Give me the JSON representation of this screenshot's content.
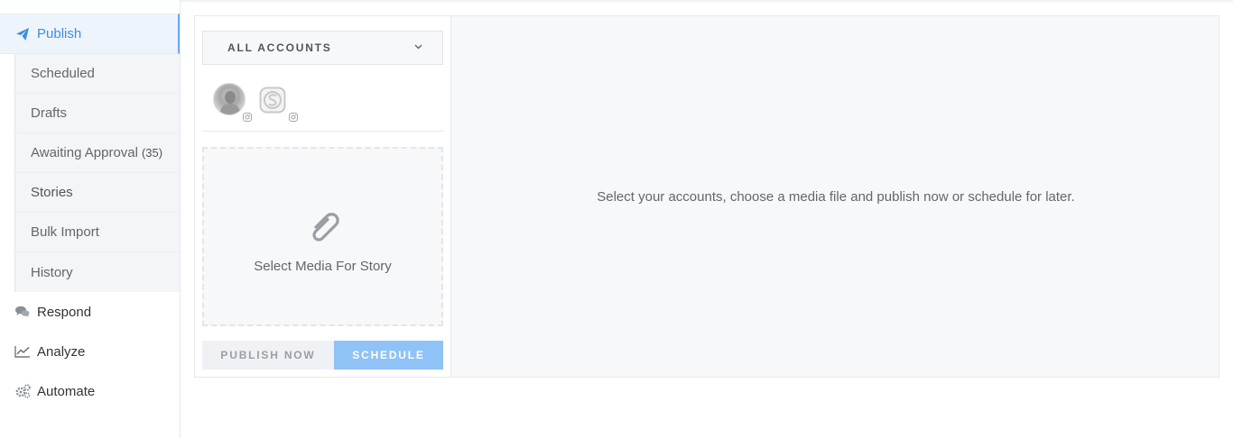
{
  "sidebar": {
    "publish": {
      "label": "Publish",
      "icon": "paper-plane-icon"
    },
    "subitems": [
      {
        "label": "Scheduled"
      },
      {
        "label": "Drafts"
      },
      {
        "label": "Awaiting Approval",
        "count": "(35)"
      },
      {
        "label": "Stories"
      },
      {
        "label": "Bulk Import"
      },
      {
        "label": "History"
      }
    ],
    "respond": {
      "label": "Respond",
      "icon": "chat-bubbles-icon"
    },
    "analyze": {
      "label": "Analyze",
      "icon": "line-chart-icon"
    },
    "automate": {
      "label": "Automate",
      "icon": "gears-icon"
    }
  },
  "composer": {
    "accounts_select": {
      "label": "ALL ACCOUNTS",
      "icon": "chevron-down-icon"
    },
    "accounts": [
      {
        "type": "avatar",
        "network": "instagram"
      },
      {
        "type": "logo",
        "network": "instagram"
      }
    ],
    "media": {
      "label": "Select Media For Story",
      "icon": "paperclip-icon"
    },
    "publish_now_label": "PUBLISH NOW",
    "schedule_label": "SCHEDULE"
  },
  "preview": {
    "hint": "Select your accounts, choose a media file and publish now or schedule for later."
  },
  "colors": {
    "accent": "#3d8ee0",
    "schedule_button": "#8fc2f7",
    "publish_active_bg": "#eef4fc"
  }
}
